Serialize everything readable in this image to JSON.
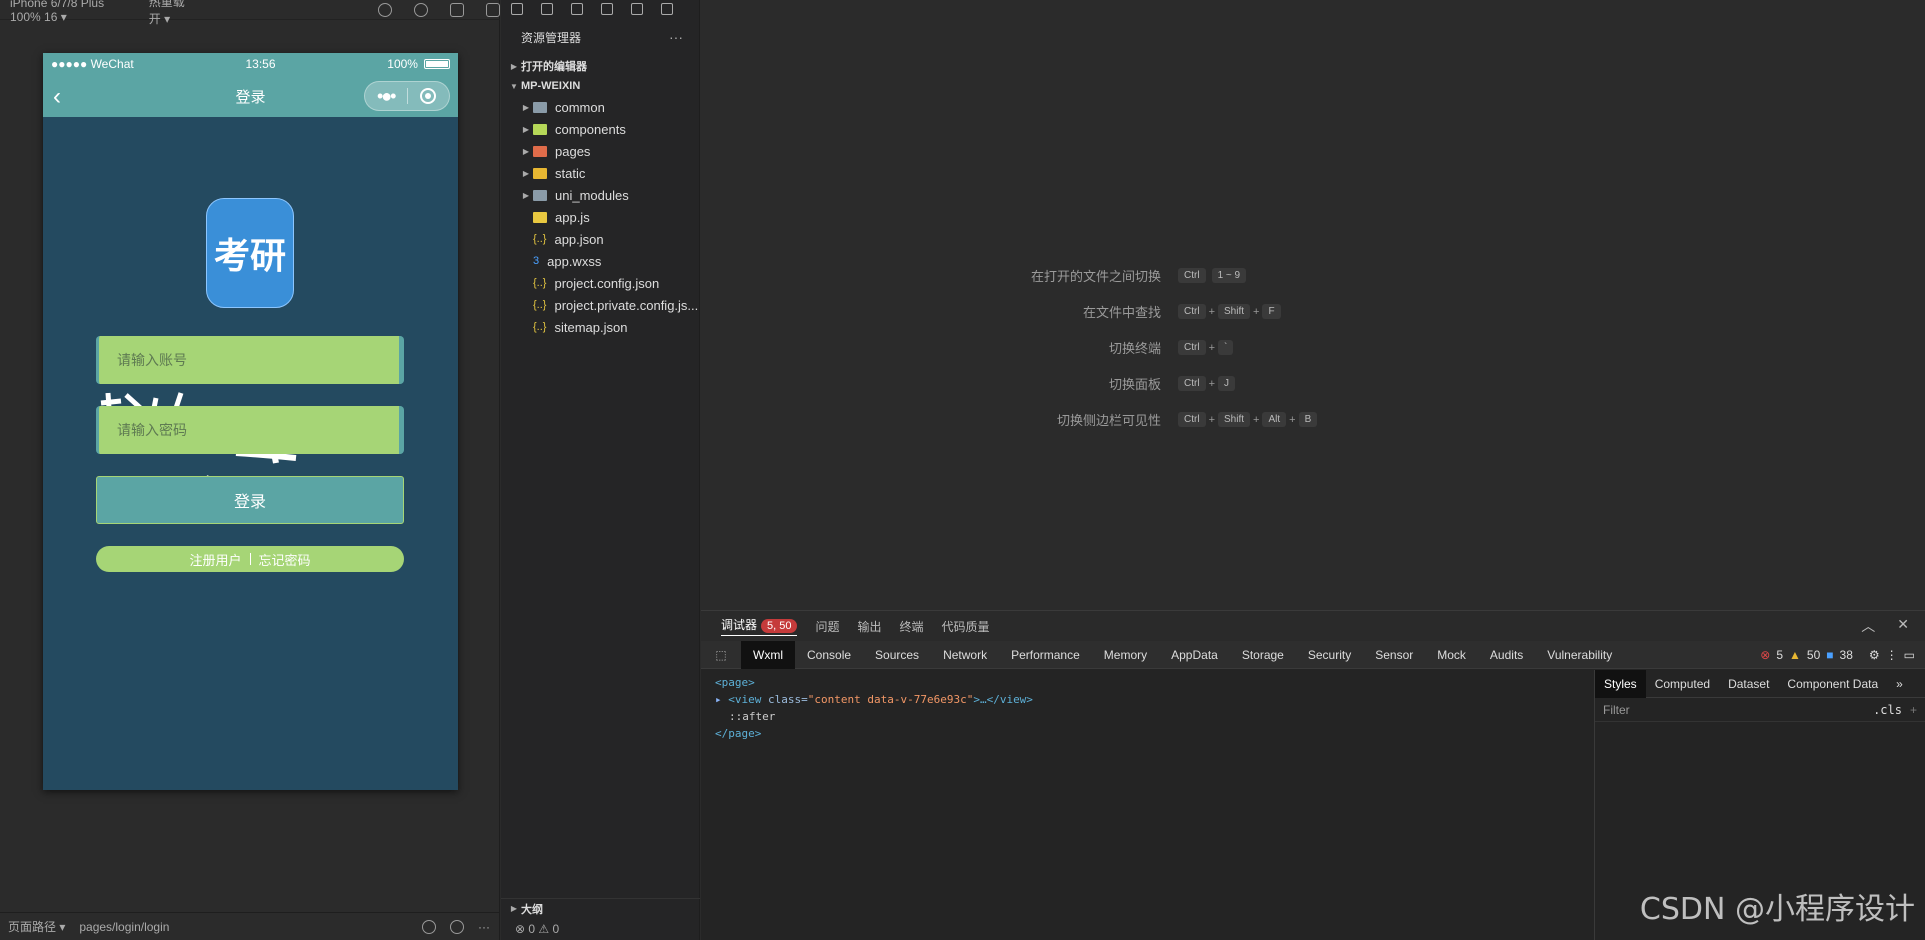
{
  "simulator": {
    "device_label": "iPhone 6/7/8 Plus 100% 16 ▾",
    "hot_reload_label": "热重载 开 ▾",
    "status": {
      "carrier": "●●●●● WeChat",
      "time": "13:56",
      "battery": "100%"
    },
    "nav_title": "登录",
    "logo_text": "考研",
    "account_placeholder": "请输入账号",
    "password_placeholder": "请输入密码",
    "login_button": "登录",
    "register_link": "注册用户",
    "forgot_link": "忘记密码",
    "bottom": {
      "path_label": "页面路径 ▾",
      "path_value": "pages/login/login",
      "more": "···"
    }
  },
  "explorer": {
    "title": "资源管理器",
    "more": "···",
    "open_editors": "打开的编辑器",
    "project": "MP-WEIXIN",
    "folders": [
      {
        "label": "common",
        "icon": "folder-icon"
      },
      {
        "label": "components",
        "icon": "components-folder-icon"
      },
      {
        "label": "pages",
        "icon": "pages-folder-icon"
      },
      {
        "label": "static",
        "icon": "static-folder-icon"
      },
      {
        "label": "uni_modules",
        "icon": "folder-icon"
      }
    ],
    "files": [
      {
        "label": "app.js",
        "icon": "js-file-icon"
      },
      {
        "label": "app.json",
        "icon": "json-file-icon"
      },
      {
        "label": "app.wxss",
        "icon": "css-file-icon"
      },
      {
        "label": "project.config.json",
        "icon": "json-file-icon"
      },
      {
        "label": "project.private.config.js...",
        "icon": "json-file-icon"
      },
      {
        "label": "sitemap.json",
        "icon": "json-file-icon"
      }
    ],
    "outline": "大纲",
    "status": "⊗ 0 ⚠ 0"
  },
  "editor": {
    "shortcuts": [
      {
        "label": "在打开的文件之间切换",
        "keys": [
          "Ctrl",
          "1 ~ 9"
        ],
        "joined": false
      },
      {
        "label": "在文件中查找",
        "keys": [
          "Ctrl",
          "Shift",
          "F"
        ],
        "joined": true
      },
      {
        "label": "切换终端",
        "keys": [
          "Ctrl",
          "`"
        ],
        "joined": true
      },
      {
        "label": "切换面板",
        "keys": [
          "Ctrl",
          "J"
        ],
        "joined": true
      },
      {
        "label": "切换侧边栏可见性",
        "keys": [
          "Ctrl",
          "Shift",
          "Alt",
          "B"
        ],
        "joined": true
      }
    ]
  },
  "devtools": {
    "top_tabs": [
      "调试器",
      "问题",
      "输出",
      "终端",
      "代码质量"
    ],
    "debugger_badge": "5, 50",
    "panel_tabs": [
      "Wxml",
      "Console",
      "Sources",
      "Network",
      "Performance",
      "Memory",
      "AppData",
      "Storage",
      "Security",
      "Sensor",
      "Mock",
      "Audits",
      "Vulnerability"
    ],
    "counts": {
      "errors": "5",
      "warnings": "50",
      "info": "38"
    },
    "wxml": {
      "page_open": "<page>",
      "view_open": "<view ",
      "attr_name": "class=",
      "attr_value": "\"content data-v-77e6e93c\"",
      "view_close": ">…</view>",
      "after": "::after",
      "page_close": "</page>"
    },
    "style_tabs": [
      "Styles",
      "Computed",
      "Dataset",
      "Component Data"
    ],
    "filter_placeholder": "Filter",
    "cls_label": ".cls"
  },
  "watermark": "CSDN @小程序设计",
  "colors": {
    "phone_bg": "#244a60",
    "nav_bg": "#5ba5a4",
    "field_bg": "#a6d576",
    "logo_bg": "#3a8fd8",
    "badge_red": "#c53b3b"
  }
}
